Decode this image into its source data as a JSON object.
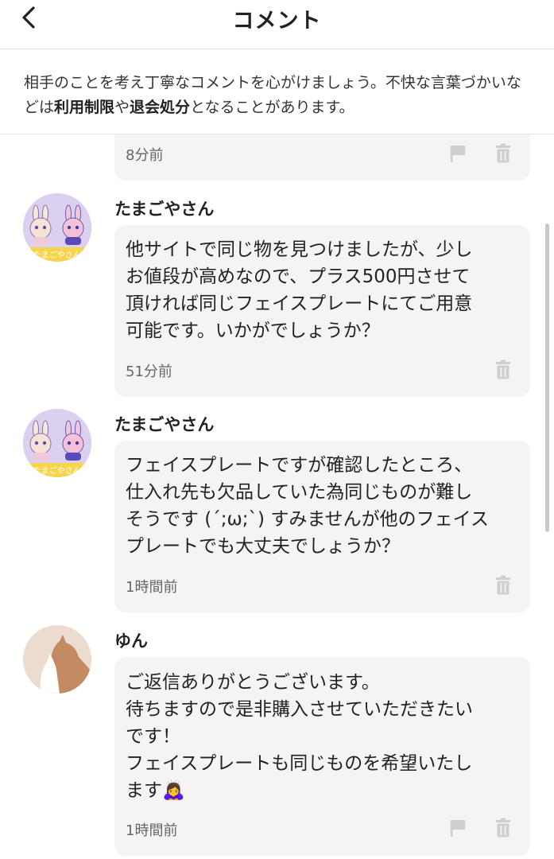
{
  "header": {
    "title": "コメント"
  },
  "notice": {
    "part1": "相手のことを考え丁寧なコメントを心がけましょう。不快な言葉づかいなどは",
    "bold1": "利用制限",
    "part2": "や",
    "bold2": "退会処分",
    "part3": "となることがあります。"
  },
  "comments": [
    {
      "time": "8分前"
    },
    {
      "user": "たまごやさん",
      "text": "他サイトで同じ物を見つけましたが、少し\nお値段が高めなので、プラス500円させて\n頂ければ同じフェイスプレートにてご用意\n可能です。いかがでしょうか？",
      "time": "51分前"
    },
    {
      "user": "たまごやさん",
      "text": "フェイスプレートですが確認したところ、\n仕入れ先も欠品していた為同じものが難し\nそうです (´;ω;`) すみませんが他のフェイス\nプレートでも大丈夫でしょうか？",
      "time": "1時間前"
    },
    {
      "user": "ゆん",
      "text": "ご返信ありがとうございます。\n待ちますので是非購入させていただきたい\nです！\nフェイスプレートも同じものを希望いたし\nます🙇‍♀️",
      "time": "1時間前"
    }
  ],
  "avatar_label": "たまごやさん",
  "colors": {
    "bubble": "#f4f4f4",
    "icon": "#cfcfcf",
    "text": "#222222"
  }
}
